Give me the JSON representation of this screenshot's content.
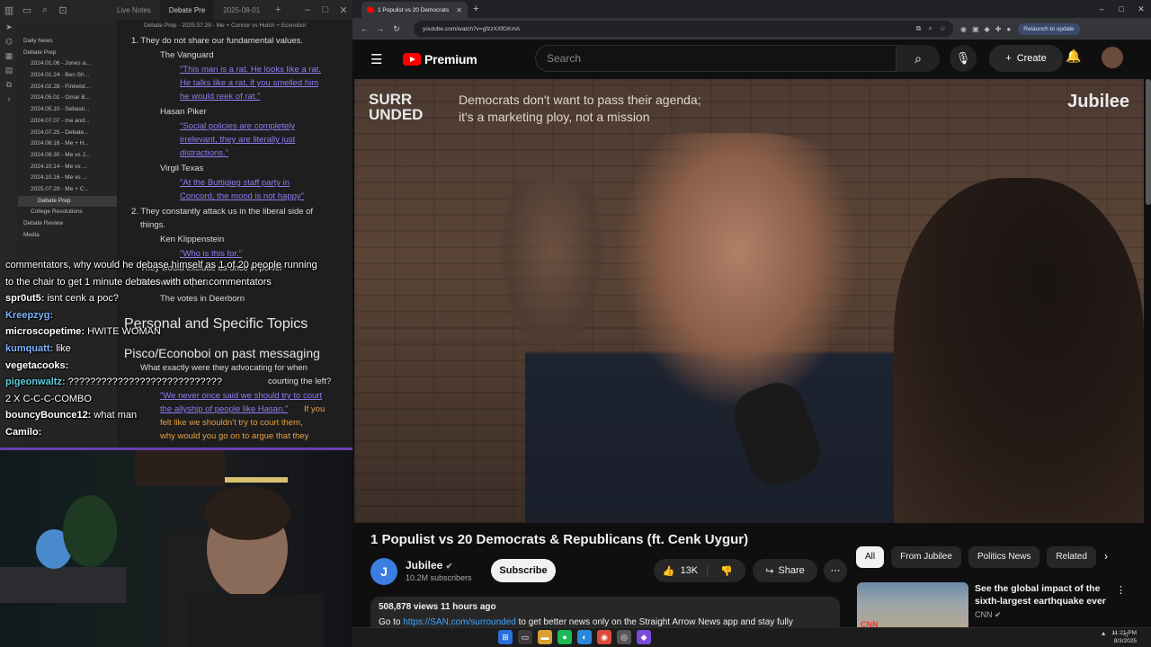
{
  "obsidian": {
    "tabs": [
      "Live Notes",
      "Debate Pre",
      "2025-08-01"
    ],
    "breadcrumb": "Debate Prep · 2025.07.29 - Me + Connor vs Hutch + Econoboi",
    "tree": [
      "Daily News",
      "Debate Prep",
      "2024.01.06 - Jones a...",
      "2024.01.24 - Ben Sh...",
      "2024.02.28 - Finkelst...",
      "2024.05.01 - Omar B...",
      "2024.05.10 - Sebasti...",
      "2024.07.07 - me and...",
      "2024.07.25 - Debate...",
      "2024.08.16 - Me + H...",
      "2024.09.30 - Me vs J...",
      "2024.10.14 - Me vs ...",
      "2024.10.16 - Me vs ...",
      "2025.07.29 - Me + C...",
      "Debate Prep",
      "College Resolutions",
      "Debate Review",
      "Media"
    ],
    "editor": {
      "l1": "1. They do not share our fundamental values.",
      "vanguard": "The Vanguard",
      "q1a": "\"This man is a rat. He looks like a rat.",
      "q1b": "He talks like a rat, if you smelled him",
      "q1c": "he would reek of rat.\"",
      "hasan": "Hasan Piker",
      "q2a": "\"Social policies are completely",
      "q2b": "irrelevant, they are literally just",
      "q2c": "distractions.\"",
      "virgil": "Virgil Texas",
      "q3a": "\"At the Buttigieg staff party in",
      "q3b": "Concord, the mood is not happy\"",
      "l2a": "2. They constantly attack us in the liberal side of",
      "l2b": "things.",
      "ken": "Ken Klippenstein",
      "q4": "\"Who is this for.\"",
      "l3": "They would exclude us once in power",
      "l4": "Real world impact",
      "votes": "The votes in Deerborn",
      "h1": "Personal and Specific Topics",
      "h2": "Pisco/Econoboi on past messaging",
      "l5": "What exactly were they advocating for when",
      "l6": "courting the left?",
      "q5a": "\"We never once said we should try to court",
      "q5b": "the allyship of people like Hasan.\"",
      "o1": "If you",
      "o2": "felt like we shouldn't try to court them,",
      "o3": "why would you go on to argue that they"
    }
  },
  "chat": [
    {
      "user": "",
      "text": "commentators, why would he debase himself as 1 of 20 people running",
      "color": "#ffffff"
    },
    {
      "user": "",
      "text": "to the chair to get 1 minute debates with other commentators",
      "color": "#ffffff"
    },
    {
      "user": "spr0ut5:",
      "text": " isnt cenk a poc?",
      "color": "#ffffff"
    },
    {
      "user": "Kreepzyg:",
      "text": "",
      "color": "#7fb4ff"
    },
    {
      "user": "microscopetime:",
      "text": " HWITE WOMAN",
      "color": "#ffffff"
    },
    {
      "user": "kumquatt:",
      "text": " like",
      "color": "#7fb4ff"
    },
    {
      "user": "vegetacooks:",
      "text": "",
      "color": "#ffffff"
    },
    {
      "user": "pigeonwaltz:",
      "text": " ????????????????????????????",
      "color": "#5fd0e0"
    },
    {
      "user": "",
      "text": "2 X C-C-C-COMBO",
      "color": "#ffffff"
    },
    {
      "user": "bouncyBounce12:",
      "text": " what man",
      "color": "#ffffff"
    },
    {
      "user": "Camilo:",
      "text": "",
      "color": "#ffffff"
    }
  ],
  "browser": {
    "tab_title": "1 Populist vs 20 Democrats",
    "url": "youtube.com/watch?v=gfzzXXfGKmA",
    "relaunch": "Relaunch to update"
  },
  "youtube": {
    "brand": "Premium",
    "search_placeholder": "Search",
    "create": "Create",
    "overlay_logo_1": "SURR",
    "overlay_logo_2": "UNDED",
    "overlay_line_1": "Democrats don't want to pass their agenda;",
    "overlay_line_2": "it's a marketing ploy, not a mission",
    "overlay_brand": "Jubilee",
    "title": "1 Populist vs 20 Democrats & Republicans (ft. Cenk Uygur)",
    "channel": "Jubilee",
    "channel_initial": "J",
    "subscribers": "10.2M subscribers",
    "subscribe": "Subscribe",
    "likes": "13K",
    "share": "Share",
    "views": "508,878 views  11 hours ago",
    "desc_pre": "Go to ",
    "desc_link": "https://SAN.com/surrounded",
    "desc_post": " to get better news only on the Straight Arrow News app and stay fully",
    "chips": [
      "All",
      "From Jubilee",
      "Politics News",
      "Related"
    ],
    "rec_title": "See the global impact of the sixth-largest earthquake ever",
    "rec_channel": "CNN",
    "rec_thumb_label": "CNN"
  },
  "taskbar": {
    "time": "11:21 PM",
    "date": "8/3/2025"
  }
}
